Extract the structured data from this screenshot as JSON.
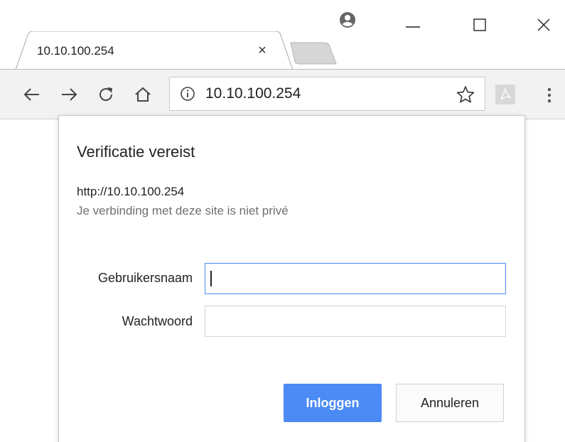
{
  "tab": {
    "title": "10.10.100.254",
    "close_glyph": "×"
  },
  "omnibox": {
    "url": "10.10.100.254"
  },
  "icons": {
    "account": "account-circle-icon",
    "back": "arrow-left-icon",
    "forward": "arrow-right-icon",
    "reload": "reload-icon",
    "home": "home-icon",
    "info": "info-icon",
    "star": "star-icon",
    "pdf": "pdf-extension-icon",
    "menu": "more-vert-icon"
  },
  "dialog": {
    "title": "Verificatie vereist",
    "url": "http://10.10.100.254",
    "note": "Je verbinding met deze site is niet privé",
    "username_label": "Gebruikersnaam",
    "username_value": "",
    "password_label": "Wachtwoord",
    "password_value": "",
    "login_label": "Inloggen",
    "cancel_label": "Annuleren"
  },
  "colors": {
    "primary_button": "#4c8bf5",
    "focus_border": "#4c8bf5",
    "toolbar_bg": "#f2f2f2"
  }
}
